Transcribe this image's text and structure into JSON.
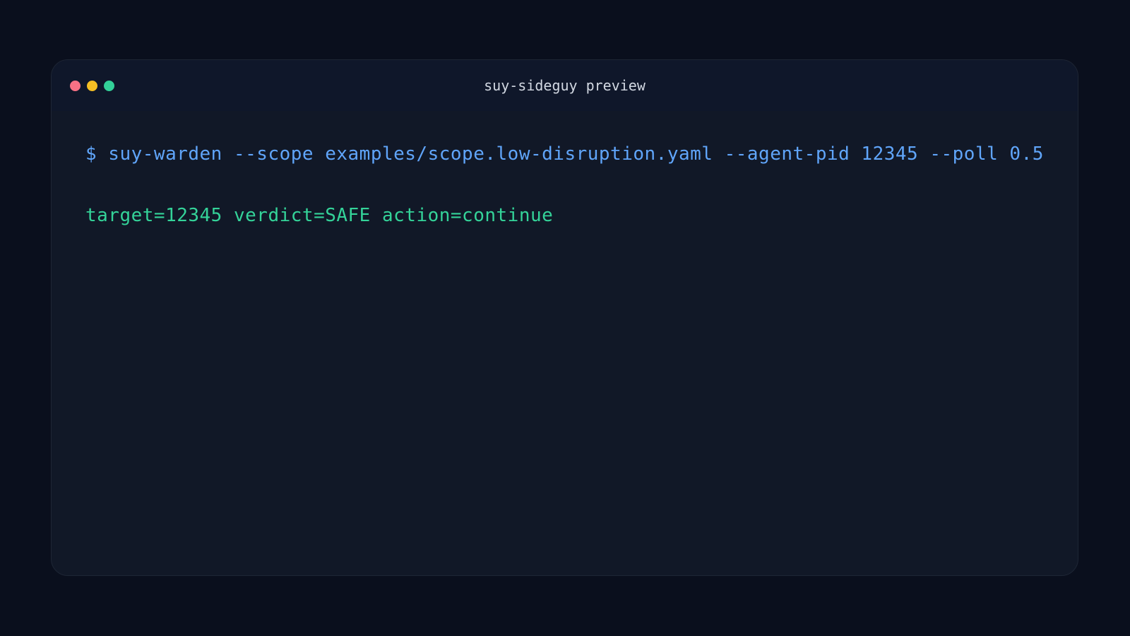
{
  "window": {
    "title": "suy-sideguy preview",
    "controls": {
      "close_color": "#f87185",
      "minimize_color": "#f5bf24",
      "maximize_color": "#33d199"
    }
  },
  "terminal": {
    "command": "$ suy-warden --scope examples/scope.low-disruption.yaml --agent-pid 12345 --poll 0.5",
    "output": "target=12345 verdict=SAFE action=continue",
    "command_color": "#60a5fa",
    "output_color": "#34d399"
  }
}
